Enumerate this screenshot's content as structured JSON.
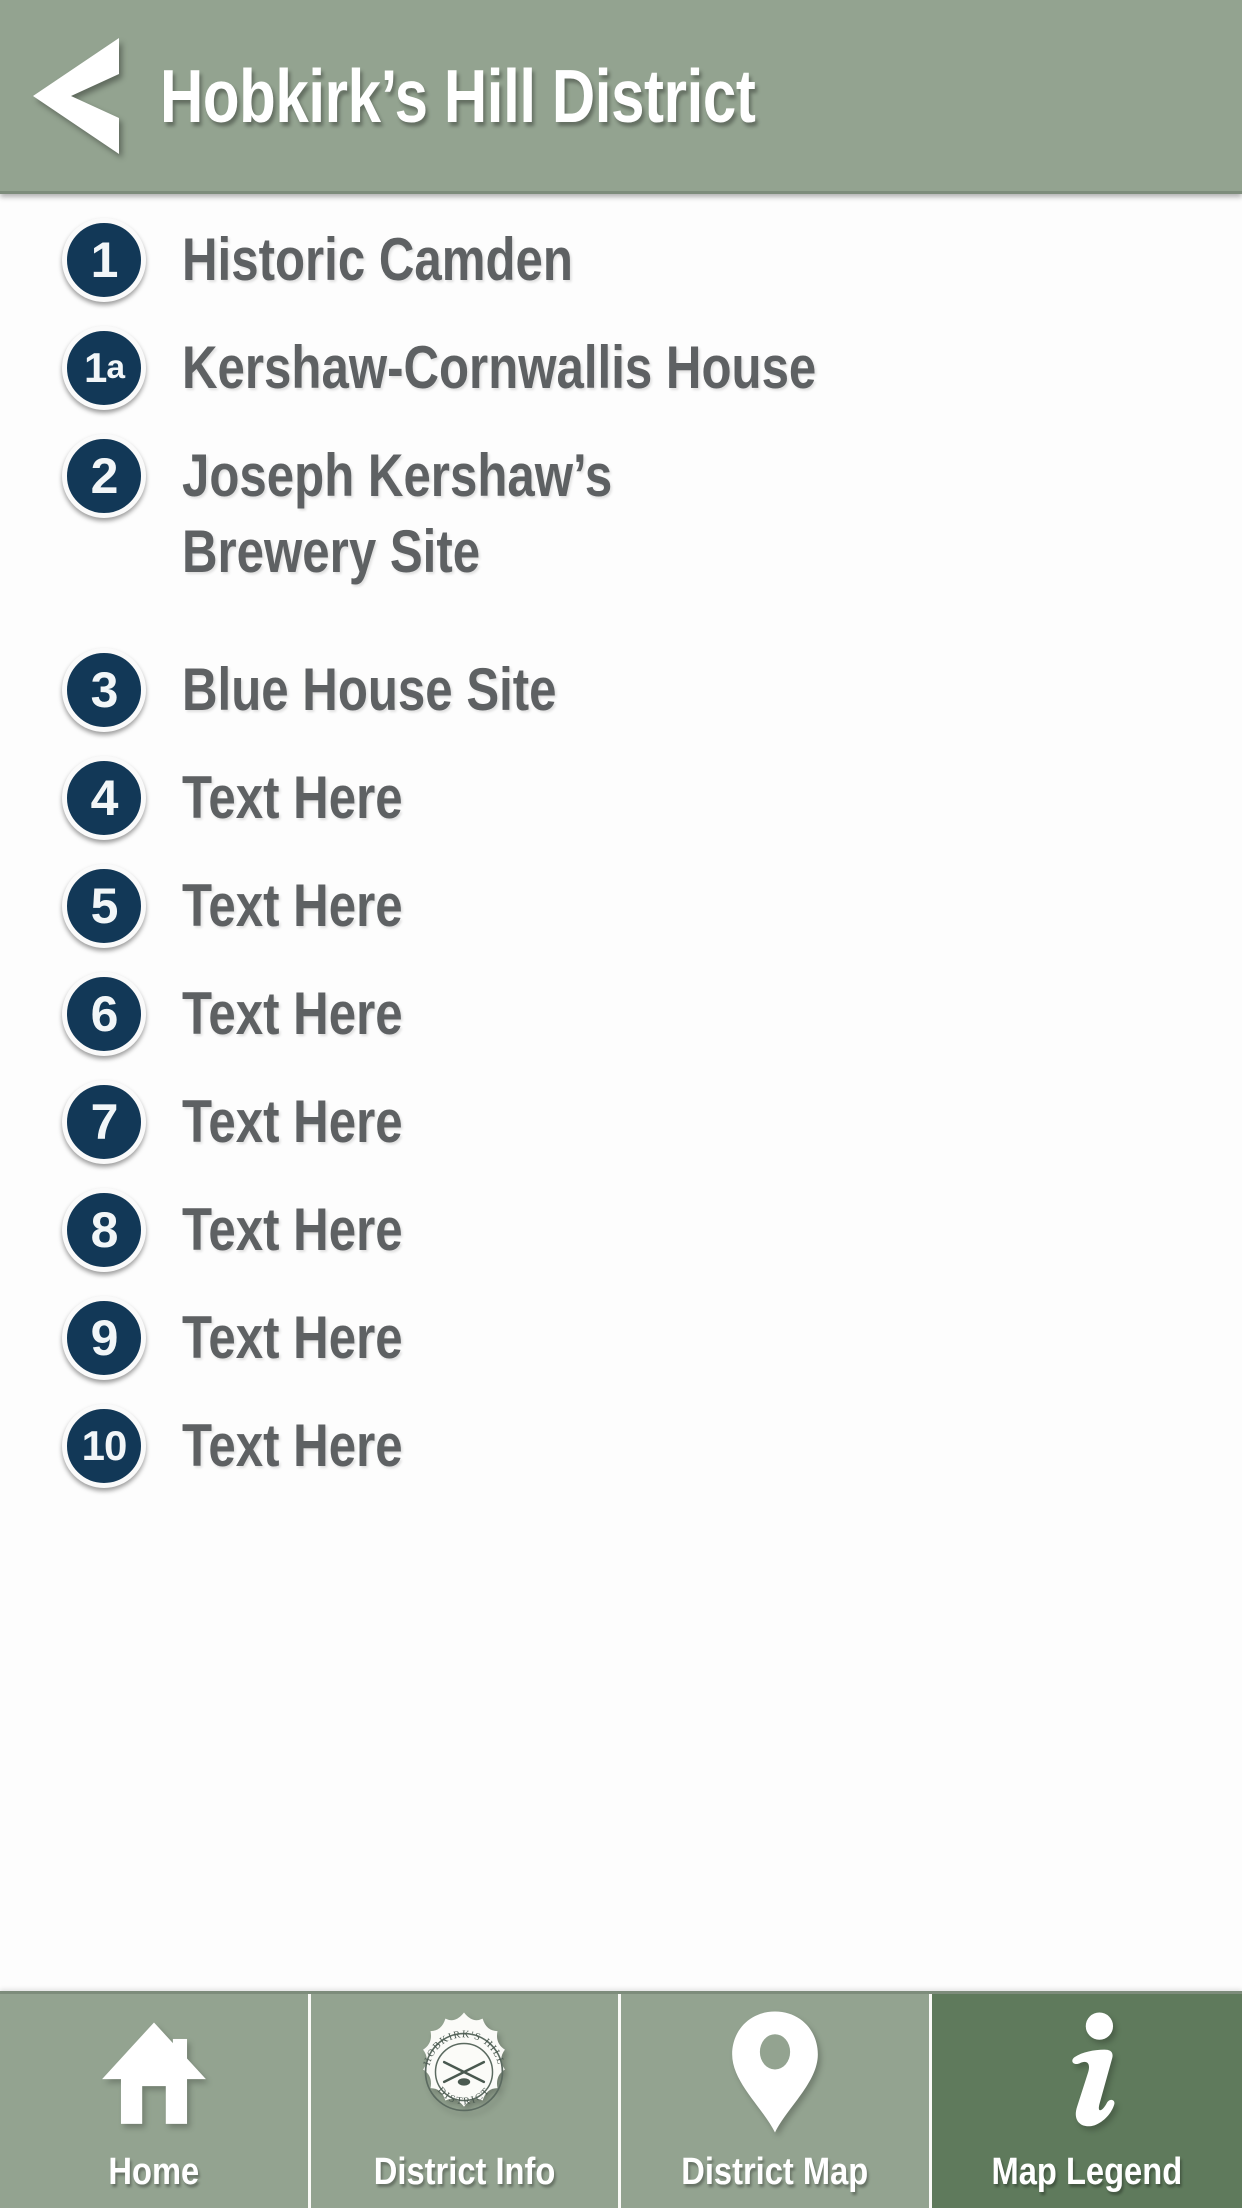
{
  "header": {
    "title": "Hobkirk’s Hill District",
    "back_icon": "chevron-left-icon",
    "background_color": "#93a390",
    "title_color": "#ffffff"
  },
  "theme": {
    "badge_navy": "#123857",
    "badge_ring": "#fafafa",
    "label_gray": "#5e6163",
    "tab_inactive": "#93a390",
    "tab_active": "#5f7a5c",
    "page_background": "#fdfdfd"
  },
  "list": {
    "items": [
      {
        "number": "1",
        "label": "Historic Camden"
      },
      {
        "number": "1a",
        "label": "Kershaw-Cornwallis House"
      },
      {
        "number": "2",
        "label": "Joseph Kershaw’s\nBrewery Site"
      },
      {
        "number": "3",
        "label": "Blue House Site"
      },
      {
        "number": "4",
        "label": "Text Here"
      },
      {
        "number": "5",
        "label": "Text Here"
      },
      {
        "number": "6",
        "label": "Text Here"
      },
      {
        "number": "7",
        "label": "Text Here"
      },
      {
        "number": "8",
        "label": "Text Here"
      },
      {
        "number": "9",
        "label": "Text Here"
      },
      {
        "number": "10",
        "label": "Text Here"
      }
    ]
  },
  "tabbar": {
    "tabs": [
      {
        "label": "Home",
        "icon": "home-icon",
        "active": false
      },
      {
        "label": "District Info",
        "icon": "district-seal-icon",
        "active": false
      },
      {
        "label": "District Map",
        "icon": "map-pin-icon",
        "active": false
      },
      {
        "label": "Map Legend",
        "icon": "info-italic-i-icon",
        "active": true
      }
    ]
  },
  "seal": {
    "top_text": "HOBKIRK'S HILL",
    "bottom_text": "DISTRICT",
    "center_icon": "crossed-muskets-icon"
  }
}
